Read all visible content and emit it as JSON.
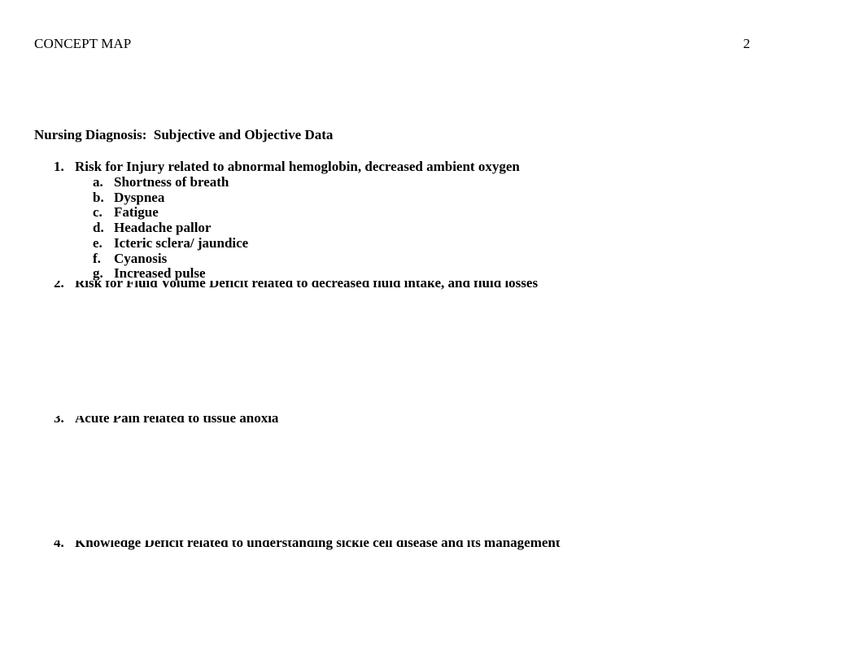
{
  "document": {
    "header": {
      "title": "CONCEPT MAP",
      "page_number": "2"
    },
    "heading": "Nursing Diagnosis:  Subjective and Objective Data",
    "list": [
      {
        "marker": "1.",
        "text": "Risk for Injury related to abnormal hemoglobin, decreased ambient oxygen",
        "clipped": false,
        "subitems": [
          {
            "marker": "a.",
            "text": "Shortness of breath"
          },
          {
            "marker": "b.",
            "text": "Dyspnea"
          },
          {
            "marker": "c.",
            "text": "Fatigue"
          },
          {
            "marker": "d.",
            "text": "Headache pallor"
          },
          {
            "marker": "e.",
            "text": "Icteric sclera/ jaundice"
          },
          {
            "marker": "f.",
            "text": "Cyanosis"
          },
          {
            "marker": "g.",
            "text": "Increased pulse"
          }
        ]
      },
      {
        "marker": "2.",
        "text": "Risk for Fluid Volume Deficit related to decreased fluid intake, and fluid losses",
        "clipped": true,
        "subitems": []
      },
      {
        "marker": "3.",
        "text": "Acute Pain related to tissue anoxia",
        "clipped": true,
        "subitems": []
      },
      {
        "marker": "4.",
        "text": "Knowledge Deficit related to understanding sickle cell disease and its management",
        "clipped": true,
        "subitems": []
      }
    ]
  }
}
